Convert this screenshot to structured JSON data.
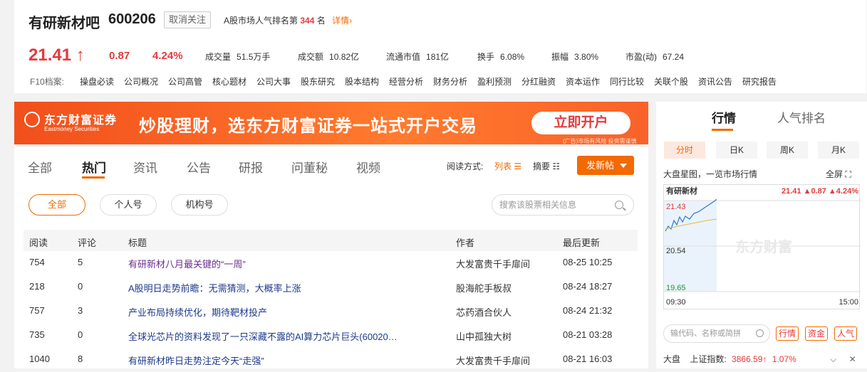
{
  "header": {
    "stock_name": "有研新材吧",
    "stock_code": "600206",
    "unfollow_label": "取消关注",
    "rank_prefix": "A股市场人气排名第",
    "rank_value": "344",
    "rank_suffix": "名",
    "detail_label": "详情",
    "price": "21.41",
    "price_arrow": "↑",
    "change": "0.87",
    "change_pct": "4.24%",
    "metrics": [
      {
        "label": "成交量",
        "value": "51.5万手"
      },
      {
        "label": "成交额",
        "value": "10.82亿"
      },
      {
        "label": "流通市值",
        "value": "181亿"
      },
      {
        "label": "换手",
        "value": "6.08%"
      },
      {
        "label": "振幅",
        "value": "3.80%"
      },
      {
        "label": "市盈(动)",
        "value": "67.24"
      }
    ],
    "f10_label": "F10档案:",
    "f10_links": [
      "操盘必读",
      "公司概况",
      "公司高管",
      "核心题材",
      "公司大事",
      "股东研究",
      "股本结构",
      "经营分析",
      "财务分析",
      "盈利预测",
      "分红融资",
      "资本运作",
      "同行比较",
      "关联个股",
      "资讯公告",
      "研究报告"
    ]
  },
  "banner": {
    "logo_cn": "东方财富证券",
    "logo_en": "Eastmoney Securities",
    "headline": "炒股理财，选东方财富证券一站式开户交易",
    "button": "立即开户",
    "note": "(广告)市场有风险 投资需谨慎"
  },
  "feed": {
    "tabs": [
      "全部",
      "热门",
      "资讯",
      "公告",
      "研报",
      "问董秘",
      "视频"
    ],
    "active_tab": "热门",
    "read_mode_label": "阅读方式:",
    "list_mode": "列表",
    "summary_mode": "摘要",
    "post_button": "发新帖",
    "filters": [
      "全部",
      "个人号",
      "机构号"
    ],
    "search_placeholder": "搜索该股票相关信息",
    "columns": [
      "阅读",
      "评论",
      "标题",
      "作者",
      "最后更新"
    ],
    "rows": [
      {
        "reads": "754",
        "comments": "5",
        "title": "有研新材八月最关键的“一周”",
        "author": "大发富贵千手扉间",
        "updated": "08-25 10:25",
        "visited": true
      },
      {
        "reads": "218",
        "comments": "0",
        "title": "A股明日走势前瞻：无需猜测，大概率上涨",
        "author": "股海舵手板叔",
        "updated": "08-24 18:27",
        "visited": false
      },
      {
        "reads": "757",
        "comments": "3",
        "title": "产业布局持续优化，期待靶材投产",
        "author": "芯药酒合伙人",
        "updated": "08-24 21:32",
        "visited": false
      },
      {
        "reads": "735",
        "comments": "0",
        "title": "全球光芯片的资料发现了一只深藏不露的AI算力芯片巨头(60020…",
        "author": "山中孤独大树",
        "updated": "08-21 03:28",
        "visited": false
      },
      {
        "reads": "1040",
        "comments": "8",
        "title": "有研新材昨日走势注定今天“走强”",
        "author": "大发富贵千手扉间",
        "updated": "08-21 16:03",
        "visited": false
      }
    ]
  },
  "side": {
    "tabs": [
      "行情",
      "人气排名"
    ],
    "periods": [
      "分时",
      "日K",
      "周K",
      "月K"
    ],
    "chart_title": "大盘星图，一览市场行情",
    "fullscreen": "全屏",
    "chart": {
      "name": "有研新材",
      "quote": "21.41 ▲0.87 ▲4.24%",
      "y_top": "21.43",
      "y_mid": "20.54",
      "y_bottom": "19.65",
      "x_start": "09:30",
      "x_end": "15:00",
      "watermark": "东方财富"
    },
    "search_placeholder": "输代码、名称或简拼",
    "tags": [
      "行情",
      "资金",
      "人气"
    ],
    "index_label": "大盘",
    "index_name": "上证指数:",
    "index_value": "3866.59↑",
    "index_pct": "1.07%"
  }
}
